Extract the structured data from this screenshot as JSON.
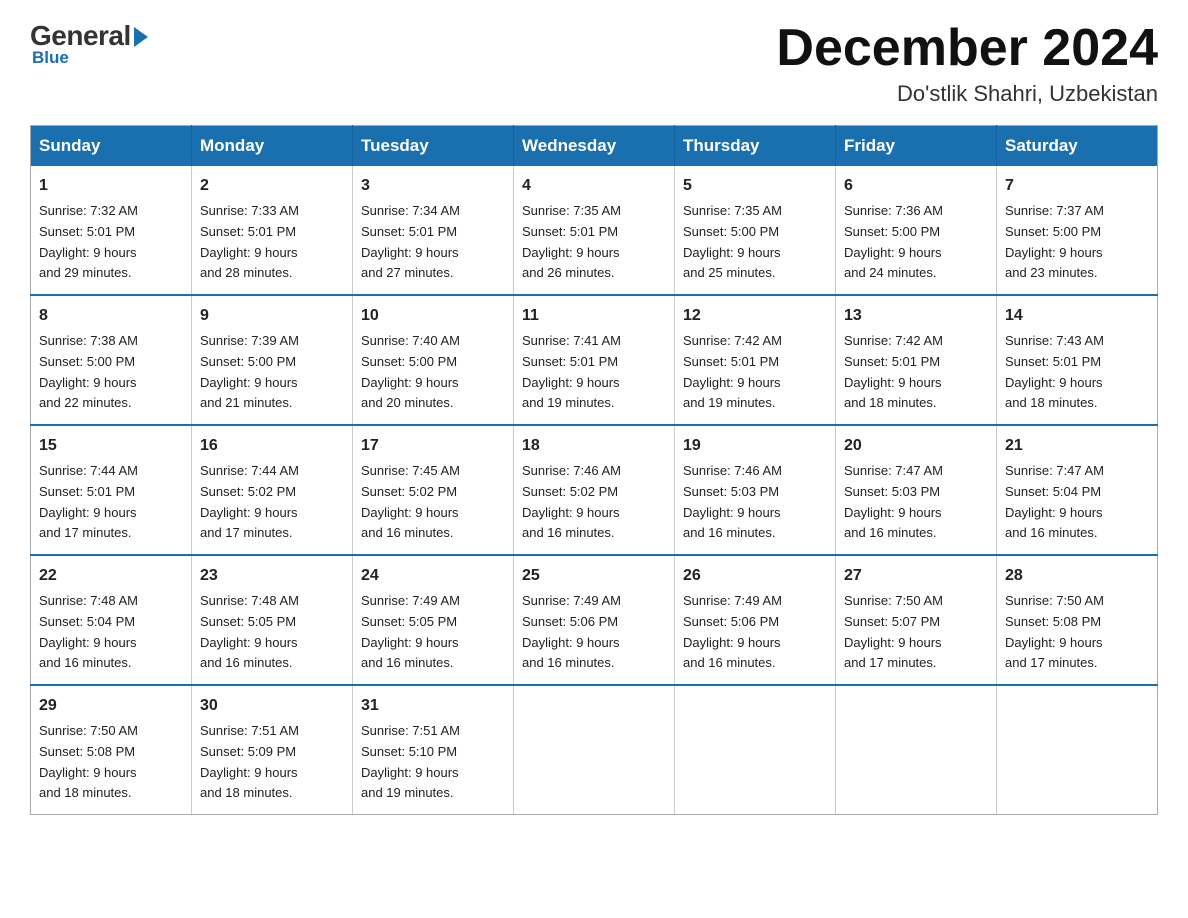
{
  "logo": {
    "general": "General",
    "blue": "Blue"
  },
  "header": {
    "month": "December 2024",
    "location": "Do'stlik Shahri, Uzbekistan"
  },
  "days_of_week": [
    "Sunday",
    "Monday",
    "Tuesday",
    "Wednesday",
    "Thursday",
    "Friday",
    "Saturday"
  ],
  "weeks": [
    [
      {
        "day": "1",
        "sunrise": "7:32 AM",
        "sunset": "5:01 PM",
        "daylight": "9 hours and 29 minutes."
      },
      {
        "day": "2",
        "sunrise": "7:33 AM",
        "sunset": "5:01 PM",
        "daylight": "9 hours and 28 minutes."
      },
      {
        "day": "3",
        "sunrise": "7:34 AM",
        "sunset": "5:01 PM",
        "daylight": "9 hours and 27 minutes."
      },
      {
        "day": "4",
        "sunrise": "7:35 AM",
        "sunset": "5:01 PM",
        "daylight": "9 hours and 26 minutes."
      },
      {
        "day": "5",
        "sunrise": "7:35 AM",
        "sunset": "5:00 PM",
        "daylight": "9 hours and 25 minutes."
      },
      {
        "day": "6",
        "sunrise": "7:36 AM",
        "sunset": "5:00 PM",
        "daylight": "9 hours and 24 minutes."
      },
      {
        "day": "7",
        "sunrise": "7:37 AM",
        "sunset": "5:00 PM",
        "daylight": "9 hours and 23 minutes."
      }
    ],
    [
      {
        "day": "8",
        "sunrise": "7:38 AM",
        "sunset": "5:00 PM",
        "daylight": "9 hours and 22 minutes."
      },
      {
        "day": "9",
        "sunrise": "7:39 AM",
        "sunset": "5:00 PM",
        "daylight": "9 hours and 21 minutes."
      },
      {
        "day": "10",
        "sunrise": "7:40 AM",
        "sunset": "5:00 PM",
        "daylight": "9 hours and 20 minutes."
      },
      {
        "day": "11",
        "sunrise": "7:41 AM",
        "sunset": "5:01 PM",
        "daylight": "9 hours and 19 minutes."
      },
      {
        "day": "12",
        "sunrise": "7:42 AM",
        "sunset": "5:01 PM",
        "daylight": "9 hours and 19 minutes."
      },
      {
        "day": "13",
        "sunrise": "7:42 AM",
        "sunset": "5:01 PM",
        "daylight": "9 hours and 18 minutes."
      },
      {
        "day": "14",
        "sunrise": "7:43 AM",
        "sunset": "5:01 PM",
        "daylight": "9 hours and 18 minutes."
      }
    ],
    [
      {
        "day": "15",
        "sunrise": "7:44 AM",
        "sunset": "5:01 PM",
        "daylight": "9 hours and 17 minutes."
      },
      {
        "day": "16",
        "sunrise": "7:44 AM",
        "sunset": "5:02 PM",
        "daylight": "9 hours and 17 minutes."
      },
      {
        "day": "17",
        "sunrise": "7:45 AM",
        "sunset": "5:02 PM",
        "daylight": "9 hours and 16 minutes."
      },
      {
        "day": "18",
        "sunrise": "7:46 AM",
        "sunset": "5:02 PM",
        "daylight": "9 hours and 16 minutes."
      },
      {
        "day": "19",
        "sunrise": "7:46 AM",
        "sunset": "5:03 PM",
        "daylight": "9 hours and 16 minutes."
      },
      {
        "day": "20",
        "sunrise": "7:47 AM",
        "sunset": "5:03 PM",
        "daylight": "9 hours and 16 minutes."
      },
      {
        "day": "21",
        "sunrise": "7:47 AM",
        "sunset": "5:04 PM",
        "daylight": "9 hours and 16 minutes."
      }
    ],
    [
      {
        "day": "22",
        "sunrise": "7:48 AM",
        "sunset": "5:04 PM",
        "daylight": "9 hours and 16 minutes."
      },
      {
        "day": "23",
        "sunrise": "7:48 AM",
        "sunset": "5:05 PM",
        "daylight": "9 hours and 16 minutes."
      },
      {
        "day": "24",
        "sunrise": "7:49 AM",
        "sunset": "5:05 PM",
        "daylight": "9 hours and 16 minutes."
      },
      {
        "day": "25",
        "sunrise": "7:49 AM",
        "sunset": "5:06 PM",
        "daylight": "9 hours and 16 minutes."
      },
      {
        "day": "26",
        "sunrise": "7:49 AM",
        "sunset": "5:06 PM",
        "daylight": "9 hours and 16 minutes."
      },
      {
        "day": "27",
        "sunrise": "7:50 AM",
        "sunset": "5:07 PM",
        "daylight": "9 hours and 17 minutes."
      },
      {
        "day": "28",
        "sunrise": "7:50 AM",
        "sunset": "5:08 PM",
        "daylight": "9 hours and 17 minutes."
      }
    ],
    [
      {
        "day": "29",
        "sunrise": "7:50 AM",
        "sunset": "5:08 PM",
        "daylight": "9 hours and 18 minutes."
      },
      {
        "day": "30",
        "sunrise": "7:51 AM",
        "sunset": "5:09 PM",
        "daylight": "9 hours and 18 minutes."
      },
      {
        "day": "31",
        "sunrise": "7:51 AM",
        "sunset": "5:10 PM",
        "daylight": "9 hours and 19 minutes."
      },
      null,
      null,
      null,
      null
    ]
  ],
  "labels": {
    "sunrise": "Sunrise:",
    "sunset": "Sunset:",
    "daylight": "Daylight:"
  }
}
